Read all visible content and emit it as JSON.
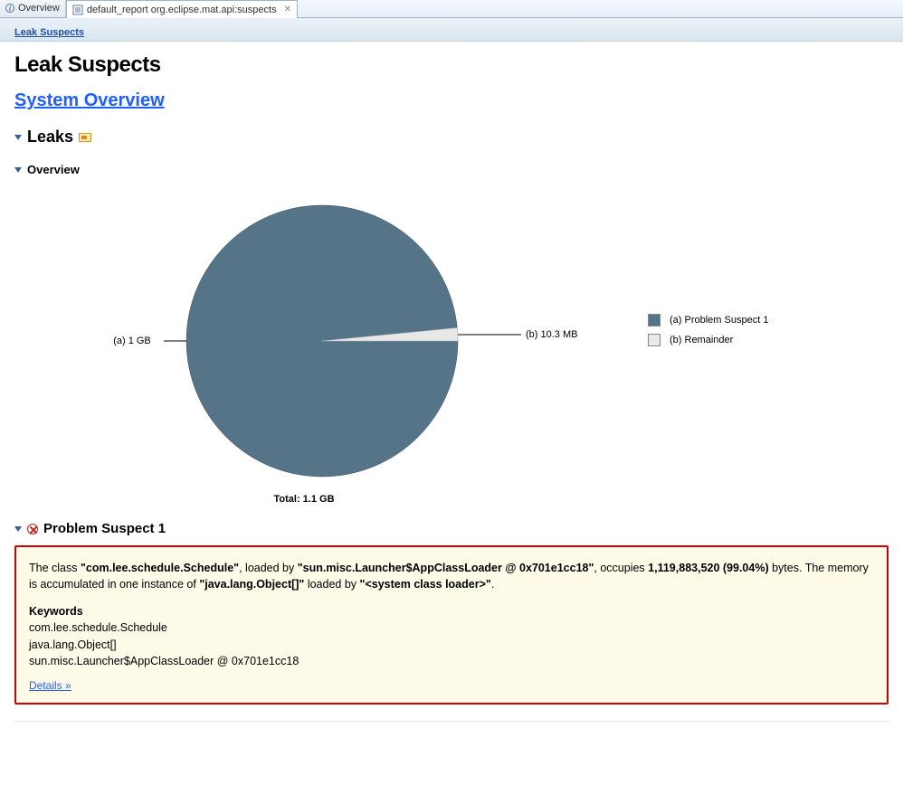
{
  "tabs": {
    "overview_label": "Overview",
    "active_label": "default_report  org.eclipse.mat.api:suspects"
  },
  "breadcrumb": {
    "leak_suspects": "Leak Suspects"
  },
  "page_title": "Leak Suspects",
  "system_overview_link": "System Overview",
  "sections": {
    "leaks": "Leaks",
    "overview": "Overview",
    "problem_suspect_1": "Problem Suspect 1"
  },
  "chart_data": {
    "type": "pie",
    "title": "",
    "total_label": "Total: 1.1 GB",
    "slices": [
      {
        "key": "a",
        "label": "(a) 1 GB",
        "legend": "(a)  Problem Suspect 1",
        "percent": 99.04,
        "color": "#557488"
      },
      {
        "key": "b",
        "label": "(b) 10.3 MB",
        "legend": "(b)  Remainder",
        "percent": 0.96,
        "color": "#e8e8e8"
      }
    ]
  },
  "problem": {
    "text_pre": "The class ",
    "class_name": "\"com.lee.schedule.Schedule\"",
    "text_loaded_by": ", loaded by ",
    "loader": "\"sun.misc.Launcher$AppClassLoader @ 0x701e1cc18\"",
    "text_occupies": ", occupies ",
    "bytes": "1,119,883,520 (99.04%)",
    "text_bytes_suffix": " bytes. The memory is accumulated in one instance of ",
    "instance": "\"java.lang.Object[]\"",
    "text_loaded_by2": " loaded by ",
    "loader2": "\"<system class loader>\"",
    "text_end": ".",
    "keywords_label": "Keywords",
    "keywords": [
      "com.lee.schedule.Schedule",
      "java.lang.Object[]",
      "sun.misc.Launcher$AppClassLoader @ 0x701e1cc18"
    ],
    "details_label": "Details »"
  }
}
